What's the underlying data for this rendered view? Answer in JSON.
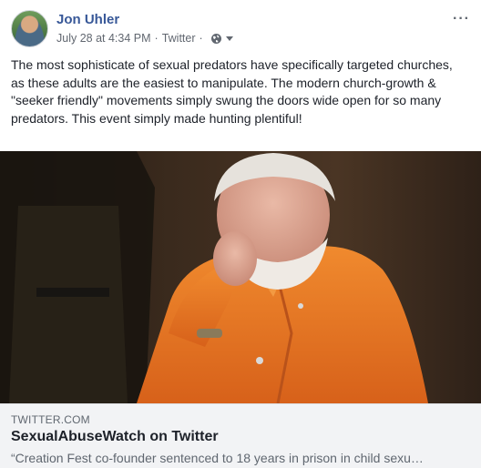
{
  "post": {
    "author": "Jon Uhler",
    "date": "July 28 at 4:34 PM",
    "source": "Twitter",
    "separator": "·",
    "visibility_icon": "globe-icon",
    "more_icon": "more-options-icon",
    "more_label": "···",
    "text": "The most sophisticate of sexual predators have specifically targeted churches, as these adults are the easiest to manipulate. The modern church-growth & \"seeker friendly\" movements simply swung the doors wide open for so many predators. This event simply made hunting plentiful!"
  },
  "link_card": {
    "domain": "TWITTER.COM",
    "title": "SexualAbuseWatch on Twitter",
    "description": "“Creation Fest co-founder sentenced to 18 years in prison in child sexu…"
  },
  "colors": {
    "author_link": "#385898",
    "meta_gray": "#616770",
    "card_bg": "#f2f3f5",
    "jumpsuit_orange": "#e8731f"
  }
}
